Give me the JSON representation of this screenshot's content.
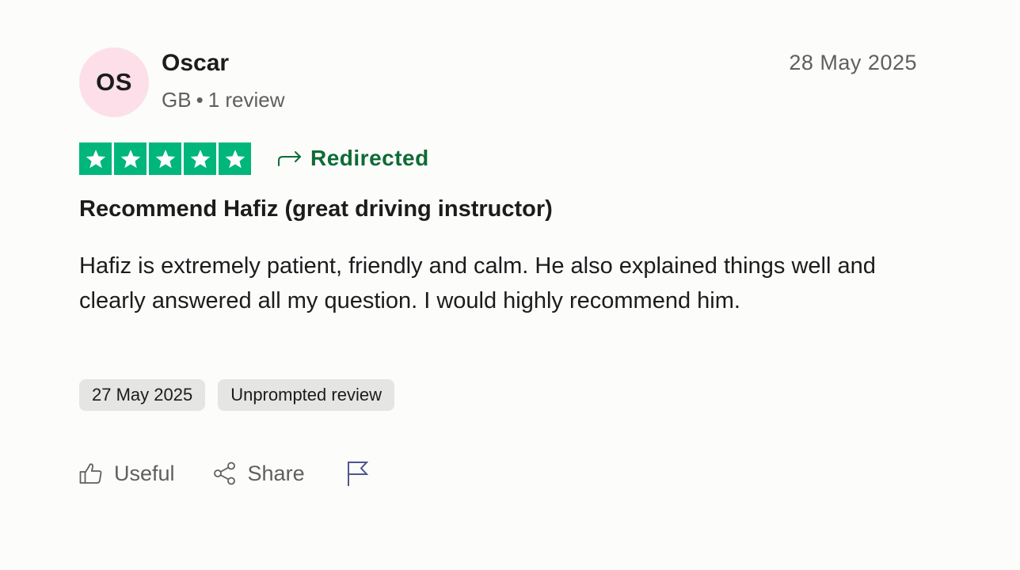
{
  "reviewer": {
    "initials": "OS",
    "name": "Oscar",
    "country": "GB",
    "separator": "•",
    "review_count": "1 review"
  },
  "review": {
    "date": "28 May 2025",
    "rating": 5,
    "rating_max": 5,
    "status": "Redirected",
    "title": "Recommend Hafiz (great driving instructor)",
    "body": "Hafiz is extremely patient, friendly and calm. He also explained things well and clearly answered all my question. I would highly recommend him.",
    "tags": [
      "27 May 2025",
      "Unprompted review"
    ]
  },
  "actions": {
    "useful_label": "Useful",
    "share_label": "Share"
  },
  "icons": {
    "star": "star-icon",
    "redirect": "redirect-arrow-icon",
    "useful": "thumbs-up-icon",
    "share": "share-icon",
    "report": "flag-icon"
  },
  "colors": {
    "star_green": "#00b67a",
    "redirect_green": "#0e6b35",
    "avatar_bg": "#fcdfe9",
    "tag_bg": "#e5e5e3",
    "flag": "#4c5790"
  }
}
